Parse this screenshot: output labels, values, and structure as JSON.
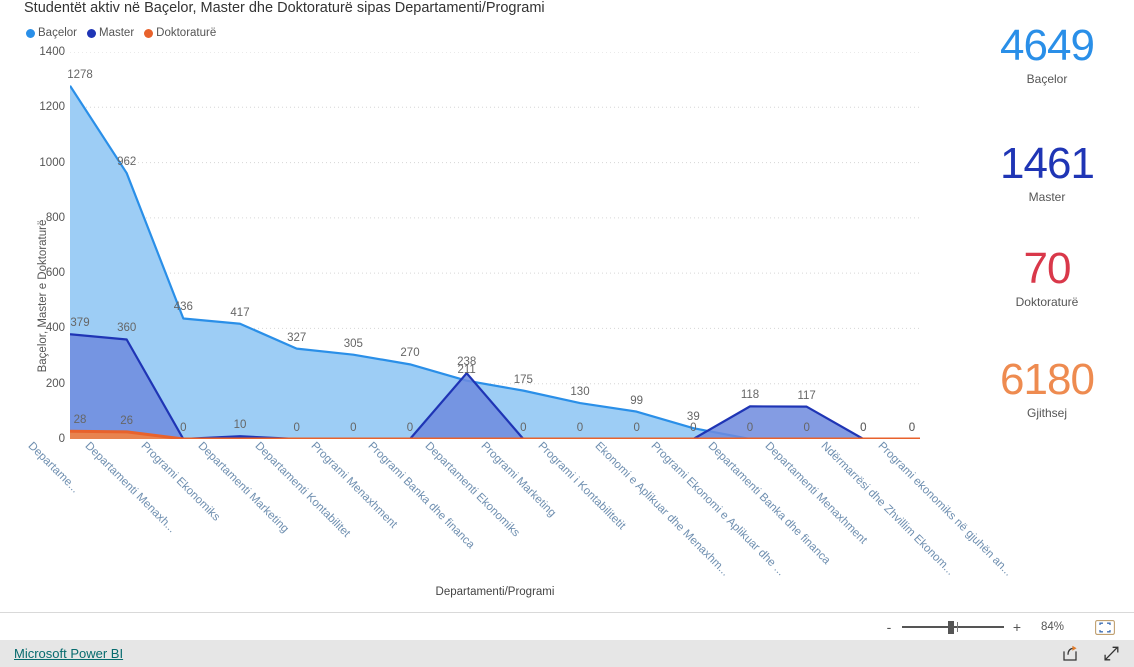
{
  "chart_data": {
    "type": "area",
    "title": "Studentët aktiv në Baçelor, Master dhe Doktoraturë sipas Departamenti/Programi",
    "xlabel": "Departamenti/Programi",
    "ylabel": "Baçelor, Master e Doktoraturë",
    "ylim": [
      0,
      1400
    ],
    "yticks": [
      0,
      200,
      400,
      600,
      800,
      1000,
      1200,
      1400
    ],
    "grid": true,
    "legend_position": "top-left",
    "categories": [
      "Departame...",
      "Departamenti Menaxh...",
      "Programi Ekonomiks",
      "Departamenti Marketing",
      "Departamenti Kontabilitet",
      "Programi Menaxhment",
      "Programi Banka dhe financa",
      "Departamenti Ekonomiks",
      "Programi Marketing",
      "Programi i Kontabilitetit",
      "Ekonomi e Aplikuar dhe Menaxhm...",
      "Programi Ekonomi e Aplikuar dhe ...",
      "Departamenti Banka dhe financa",
      "Departamenti Menaxhment",
      "Ndërmarrësi dhe Zhvillim Ekonom...",
      "Programi ekonomiks në gjuhën an..."
    ],
    "series": [
      {
        "name": "Baçelor",
        "color": "#2A8FE8",
        "fill": "#9DCDF5",
        "values": [
          1278,
          962,
          436,
          417,
          327,
          305,
          270,
          211,
          175,
          130,
          99,
          39,
          0,
          0,
          0,
          0
        ]
      },
      {
        "name": "Master",
        "color": "#1F35B5",
        "fill": "#6E8BDE",
        "values": [
          379,
          360,
          0,
          10,
          0,
          0,
          0,
          238,
          0,
          0,
          0,
          0,
          118,
          117,
          0,
          0
        ]
      },
      {
        "name": "Doktoraturë",
        "color": "#E8622C",
        "fill": "#E8834F",
        "values": [
          28,
          26,
          0,
          0,
          0,
          0,
          0,
          0,
          0,
          0,
          0,
          0,
          0,
          0,
          0,
          0
        ]
      }
    ]
  },
  "legend": {
    "items": [
      {
        "label": "Baçelor",
        "color": "#2A8FE8"
      },
      {
        "label": "Master",
        "color": "#1F35B5"
      },
      {
        "label": "Doktoraturë",
        "color": "#E8622C"
      }
    ]
  },
  "kpis": [
    {
      "value": "4649",
      "label": "Baçelor",
      "color": "#2A8FE8"
    },
    {
      "value": "1461",
      "label": "Master",
      "color": "#1F35B5"
    },
    {
      "value": "70",
      "label": "Doktoraturë",
      "color": "#D9384A"
    },
    {
      "value": "6180",
      "label": "Gjithsej",
      "color": "#EE8B50"
    }
  ],
  "status_bar": {
    "zoom_out_label": "-",
    "zoom_in_label": "+",
    "zoom_percent": "84%",
    "fit_icon": "fit-to-screen-icon"
  },
  "footer": {
    "brand": "Microsoft Power BI",
    "share_icon": "share-icon",
    "fullscreen_icon": "fullscreen-icon"
  }
}
